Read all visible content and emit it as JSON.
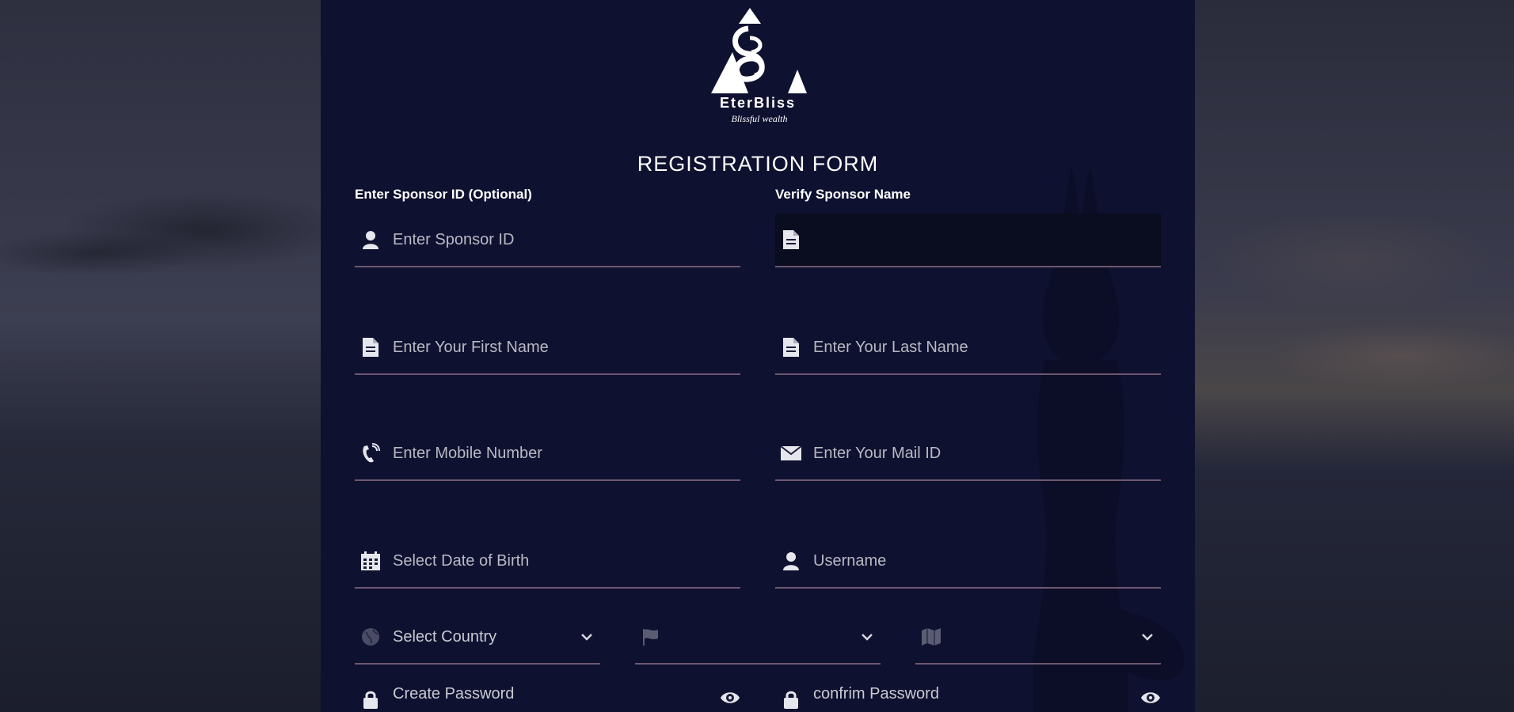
{
  "brand": {
    "name": "EterBliss",
    "tagline": "Blissful wealth"
  },
  "form": {
    "title": "REGISTRATION FORM",
    "sponsor_id_label": "Enter Sponsor ID (Optional)",
    "verify_sponsor_label": "Verify Sponsor Name",
    "fields": {
      "sponsor_id": {
        "placeholder": "Enter Sponsor ID",
        "icon": "user-icon"
      },
      "sponsor_name": {
        "placeholder": "",
        "icon": "document-icon"
      },
      "first_name": {
        "placeholder": "Enter Your First Name",
        "icon": "document-icon"
      },
      "last_name": {
        "placeholder": "Enter Your Last Name",
        "icon": "document-icon"
      },
      "mobile": {
        "placeholder": "Enter Mobile Number",
        "icon": "phone-icon"
      },
      "email": {
        "placeholder": "Enter Your Mail ID",
        "icon": "envelope-icon"
      },
      "dob": {
        "placeholder": "Select Date of Birth",
        "icon": "calendar-icon"
      },
      "username": {
        "placeholder": "Username",
        "icon": "user-icon"
      },
      "country": {
        "selected": "Select Country",
        "icon": "globe-icon"
      },
      "state": {
        "selected": "",
        "icon": "flag-icon"
      },
      "city": {
        "selected": "",
        "icon": "map-icon"
      },
      "password": {
        "placeholder": "Create Password",
        "icon": "lock-icon"
      },
      "confirm_password": {
        "placeholder": "confrim Password",
        "icon": "lock-icon"
      }
    }
  },
  "colors": {
    "panel": "#0f1130",
    "underline": "#6e5870",
    "placeholder": "#b9b9c3"
  }
}
